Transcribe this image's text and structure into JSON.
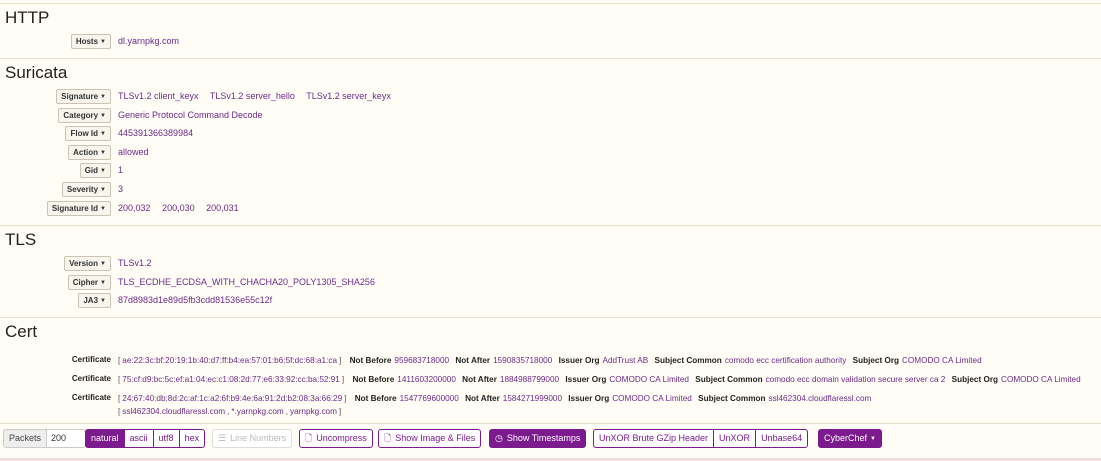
{
  "sections": {
    "http": {
      "title": "HTTP",
      "fields": [
        {
          "label": "Hosts",
          "values": [
            "dl.yarnpkg.com"
          ]
        }
      ]
    },
    "suricata": {
      "title": "Suricata",
      "fields": [
        {
          "label": "Signature",
          "values": [
            "TLSv1.2 client_keyx",
            "TLSv1.2 server_hello",
            "TLSv1.2 server_keyx"
          ]
        },
        {
          "label": "Category",
          "values": [
            "Generic Protocol Command Decode"
          ]
        },
        {
          "label": "Flow Id",
          "values": [
            "445391366389984"
          ]
        },
        {
          "label": "Action",
          "values": [
            "allowed"
          ]
        },
        {
          "label": "Gid",
          "values": [
            "1"
          ]
        },
        {
          "label": "Severity",
          "values": [
            "3"
          ]
        },
        {
          "label": "Signature Id",
          "values": [
            "200,032",
            "200,030",
            "200,031"
          ]
        }
      ]
    },
    "tls": {
      "title": "TLS",
      "fields": [
        {
          "label": "Version",
          "values": [
            "TLSv1.2"
          ]
        },
        {
          "label": "Cipher",
          "values": [
            "TLS_ECDHE_ECDSA_WITH_CHACHA20_POLY1305_SHA256"
          ]
        },
        {
          "label": "JA3",
          "values": [
            "87d8983d1e89d5fb3cdd81536e55c12f"
          ]
        }
      ]
    },
    "cert": {
      "title": "Cert",
      "label": "Certificate",
      "keys": {
        "not_before": "Not Before",
        "not_after": "Not After",
        "issuer_org": "Issuer Org",
        "subject_common": "Subject Common",
        "subject_org": "Subject Org"
      },
      "rows": [
        {
          "hash": "ae:22:3c:bf:20:19:1b:40:d7:ff:b4:ea:57:01:b6:5f:dc:68:a1:ca",
          "not_before": "959683718000",
          "not_after": "1590835718000",
          "issuer_org": "AddTrust AB",
          "subject_common": "comodo ecc certification authority",
          "subject_org": "COMODO CA Limited",
          "alt": []
        },
        {
          "hash": "75:cf:d9:bc:5c:ef:a1:04:ec:c1:08:2d:77:e6:33:92:cc:ba:52:91",
          "not_before": "1411603200000",
          "not_after": "1884988799000",
          "issuer_org": "COMODO CA Limited",
          "subject_common": "comodo ecc domain validation secure server ca 2",
          "subject_org": "COMODO CA Limited",
          "alt": []
        },
        {
          "hash": "24:67:40:db:8d:2c:af:1c:a2:6f:b9:4e:6a:91:2d:b2:08:3a:66:29",
          "not_before": "1547769600000",
          "not_after": "1584271999000",
          "issuer_org": "COMODO CA Limited",
          "subject_common": "ssl462304.cloudflaressl.com",
          "subject_org": "",
          "alt": [
            "ssl462304.cloudflaressl.com",
            "*.yarnpkg.com",
            "yarnpkg.com"
          ]
        }
      ]
    }
  },
  "toolbar": {
    "packets_label": "Packets",
    "packets_value": "200",
    "natural": "natural",
    "ascii": "ascii",
    "utf8": "utf8",
    "hex": "hex",
    "line_numbers": "Line Numbers",
    "uncompress": "Uncompress",
    "show_image_files": "Show Image & Files",
    "show_timestamps": "Show Timestamps",
    "unxor_brute": "UnXOR Brute GZip Header",
    "unxor": "UnXOR",
    "unbase64": "Unbase64",
    "cyberchef": "CyberChef"
  },
  "colors": {
    "accent": "#7b1b8e",
    "value_text": "#6b2a8a",
    "background": "#fffdf5"
  }
}
